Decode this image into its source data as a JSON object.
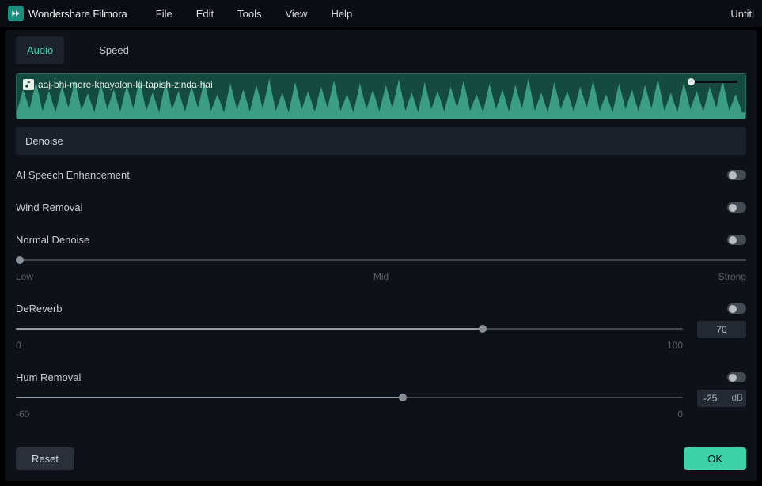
{
  "app": {
    "name": "Wondershare Filmora",
    "doc_title": "Untitl"
  },
  "menu": [
    "File",
    "Edit",
    "Tools",
    "View",
    "Help"
  ],
  "tabs": {
    "audio": "Audio",
    "speed": "Speed",
    "active": "audio"
  },
  "track": {
    "name": "aaj-bhi-mere-khayalon-ki-tapish-zinda-hai"
  },
  "section": {
    "denoise": "Denoise"
  },
  "options": {
    "ai_speech": {
      "label": "AI Speech Enhancement",
      "on": false
    },
    "wind": {
      "label": "Wind Removal",
      "on": false
    },
    "normal": {
      "label": "Normal Denoise",
      "on": false,
      "low": "Low",
      "mid": "Mid",
      "strong": "Strong",
      "value_pct": 0
    },
    "dereverb": {
      "label": "DeReverb",
      "on": false,
      "min": "0",
      "max": "100",
      "value": "70",
      "value_pct": 70
    },
    "hum": {
      "label": "Hum Removal",
      "on": false,
      "min": "-60",
      "max": "0",
      "value": "-25",
      "unit": "dB",
      "value_pct": 58
    }
  },
  "footer": {
    "reset": "Reset",
    "ok": "OK"
  }
}
